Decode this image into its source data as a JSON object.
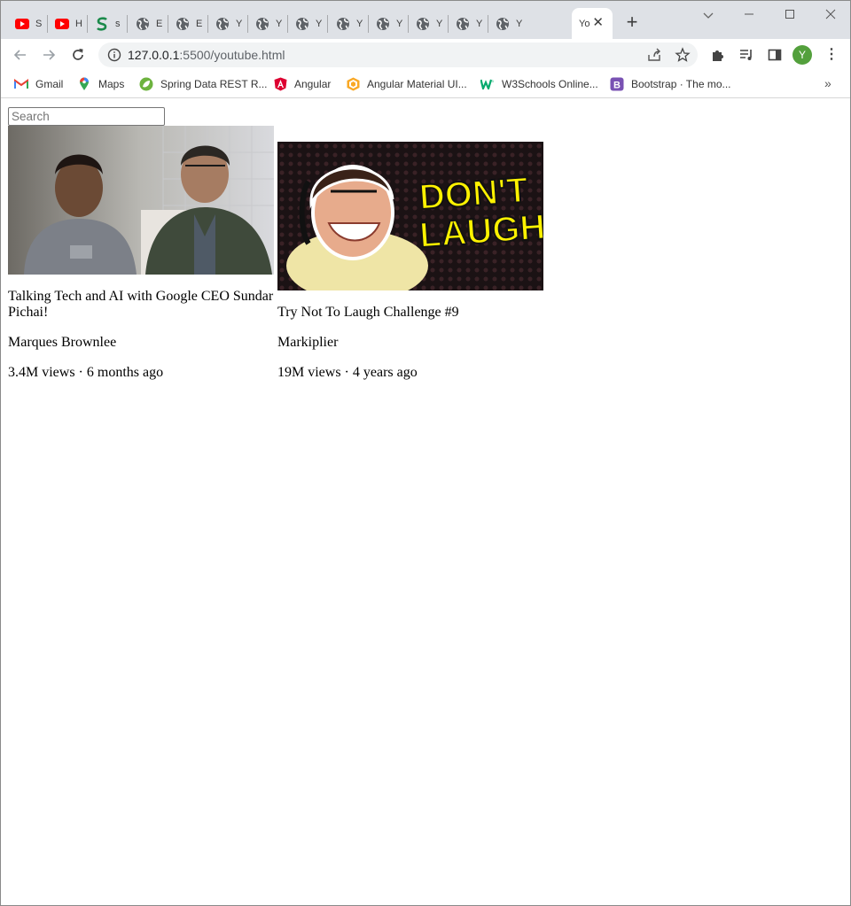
{
  "browser": {
    "tabs": [
      {
        "favicon": "youtube-icon",
        "label": "S"
      },
      {
        "favicon": "youtube-icon",
        "label": "H"
      },
      {
        "favicon": "spring-s-icon",
        "label": "s"
      },
      {
        "favicon": "globe-icon",
        "label": "E"
      },
      {
        "favicon": "globe-icon",
        "label": "E"
      },
      {
        "favicon": "globe-icon",
        "label": "Y"
      },
      {
        "favicon": "globe-icon",
        "label": "Y"
      },
      {
        "favicon": "globe-icon",
        "label": "Y"
      },
      {
        "favicon": "globe-icon",
        "label": "Y"
      },
      {
        "favicon": "globe-icon",
        "label": "Y"
      },
      {
        "favicon": "globe-icon",
        "label": "Y"
      },
      {
        "favicon": "globe-icon",
        "label": "Y"
      },
      {
        "favicon": "globe-icon",
        "label": "Y"
      }
    ],
    "active_tab": {
      "label": "Yo"
    },
    "url": {
      "host": "127.0.0.1",
      "rest": ":5500/youtube.html"
    },
    "profile_initial": "Y",
    "bookmarks": [
      {
        "icon": "gmail-icon",
        "label": "Gmail"
      },
      {
        "icon": "maps-icon",
        "label": "Maps"
      },
      {
        "icon": "spring-leaf-icon",
        "label": "Spring Data REST R..."
      },
      {
        "icon": "angular-icon",
        "label": "Angular"
      },
      {
        "icon": "angular-material-icon",
        "label": "Angular Material UI..."
      },
      {
        "icon": "w3schools-icon",
        "label": "W3Schools Online..."
      },
      {
        "icon": "bootstrap-icon",
        "label": "Bootstrap · The mo..."
      }
    ]
  },
  "page": {
    "search": {
      "placeholder": "Search",
      "value": ""
    },
    "videos": [
      {
        "title": "Talking Tech and AI with Google CEO Sundar Pichai!",
        "channel": "Marques Brownlee",
        "meta": "3.4M views · 6 months ago"
      },
      {
        "title": "Try Not To Laugh Challenge #9",
        "channel": "Markiplier",
        "meta": "19M views · 4 years ago",
        "thumb_text": [
          "DON'T",
          "LAUGH"
        ]
      }
    ]
  }
}
